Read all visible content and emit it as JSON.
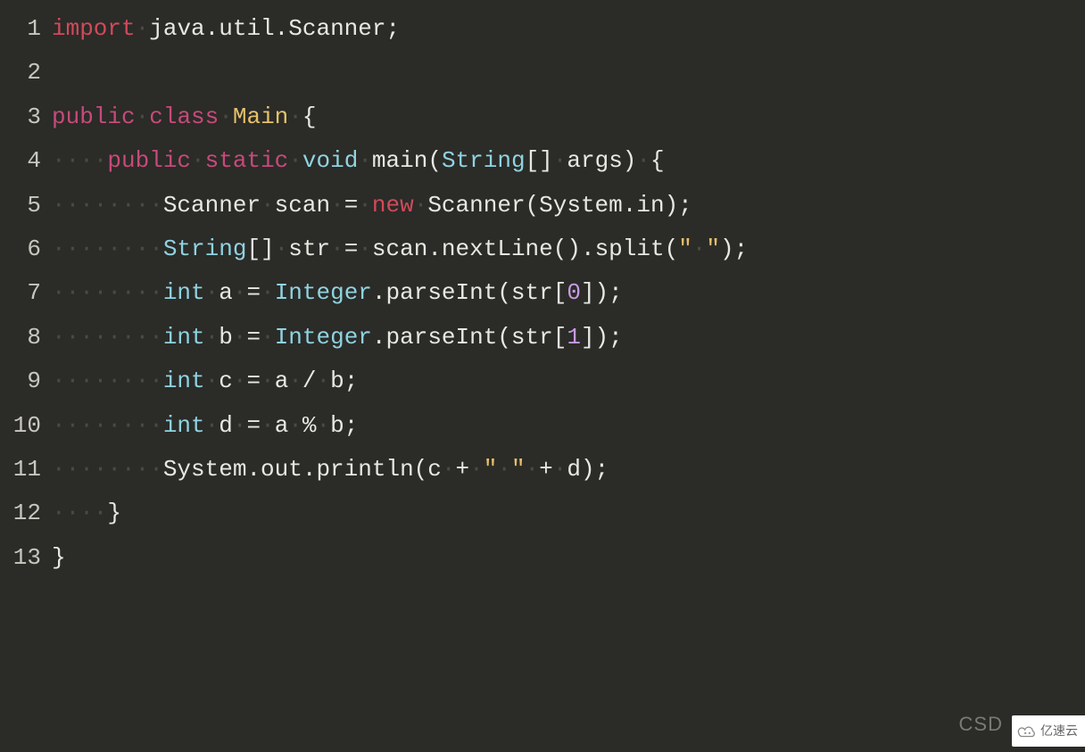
{
  "code": {
    "lines": [
      {
        "n": "1",
        "tokens": [
          {
            "t": "import",
            "c": "kw-red"
          },
          {
            "t": "·",
            "c": "dot"
          },
          {
            "t": "java.util.Scanner;",
            "c": "plain"
          }
        ]
      },
      {
        "n": "2",
        "tokens": []
      },
      {
        "n": "3",
        "tokens": [
          {
            "t": "public",
            "c": "kw-mag"
          },
          {
            "t": "·",
            "c": "dot"
          },
          {
            "t": "class",
            "c": "kw-mag"
          },
          {
            "t": "·",
            "c": "dot"
          },
          {
            "t": "Main",
            "c": "cls"
          },
          {
            "t": "·",
            "c": "dot"
          },
          {
            "t": "{",
            "c": "plain"
          }
        ]
      },
      {
        "n": "4",
        "tokens": [
          {
            "t": "····",
            "c": "dot"
          },
          {
            "t": "public",
            "c": "kw-mag"
          },
          {
            "t": "·",
            "c": "dot"
          },
          {
            "t": "static",
            "c": "kw-mag"
          },
          {
            "t": "·",
            "c": "dot"
          },
          {
            "t": "void",
            "c": "type"
          },
          {
            "t": "·",
            "c": "dot"
          },
          {
            "t": "main(",
            "c": "fn"
          },
          {
            "t": "String",
            "c": "type"
          },
          {
            "t": "[]",
            "c": "plain"
          },
          {
            "t": "·",
            "c": "dot"
          },
          {
            "t": "args)",
            "c": "plain"
          },
          {
            "t": "·",
            "c": "dot"
          },
          {
            "t": "{",
            "c": "plain"
          }
        ]
      },
      {
        "n": "5",
        "tokens": [
          {
            "t": "········",
            "c": "dot"
          },
          {
            "t": "Scanner",
            "c": "plain"
          },
          {
            "t": "·",
            "c": "dot"
          },
          {
            "t": "scan",
            "c": "plain"
          },
          {
            "t": "·",
            "c": "dot"
          },
          {
            "t": "=",
            "c": "plain"
          },
          {
            "t": "·",
            "c": "dot"
          },
          {
            "t": "new",
            "c": "kw-red"
          },
          {
            "t": "·",
            "c": "dot"
          },
          {
            "t": "Scanner(System.in);",
            "c": "plain"
          }
        ]
      },
      {
        "n": "6",
        "tokens": [
          {
            "t": "········",
            "c": "dot"
          },
          {
            "t": "String",
            "c": "type"
          },
          {
            "t": "[]",
            "c": "plain"
          },
          {
            "t": "·",
            "c": "dot"
          },
          {
            "t": "str",
            "c": "plain"
          },
          {
            "t": "·",
            "c": "dot"
          },
          {
            "t": "=",
            "c": "plain"
          },
          {
            "t": "·",
            "c": "dot"
          },
          {
            "t": "scan.nextLine().split(",
            "c": "plain"
          },
          {
            "t": "\"",
            "c": "str"
          },
          {
            "t": "·",
            "c": "dot"
          },
          {
            "t": "\"",
            "c": "str"
          },
          {
            "t": ");",
            "c": "plain"
          }
        ]
      },
      {
        "n": "7",
        "tokens": [
          {
            "t": "········",
            "c": "dot"
          },
          {
            "t": "int",
            "c": "type"
          },
          {
            "t": "·",
            "c": "dot"
          },
          {
            "t": "a",
            "c": "plain"
          },
          {
            "t": "·",
            "c": "dot"
          },
          {
            "t": "=",
            "c": "plain"
          },
          {
            "t": "·",
            "c": "dot"
          },
          {
            "t": "Integer",
            "c": "type"
          },
          {
            "t": ".parseInt(str[",
            "c": "plain"
          },
          {
            "t": "0",
            "c": "num"
          },
          {
            "t": "]);",
            "c": "plain"
          }
        ]
      },
      {
        "n": "8",
        "tokens": [
          {
            "t": "········",
            "c": "dot"
          },
          {
            "t": "int",
            "c": "type"
          },
          {
            "t": "·",
            "c": "dot"
          },
          {
            "t": "b",
            "c": "plain"
          },
          {
            "t": "·",
            "c": "dot"
          },
          {
            "t": "=",
            "c": "plain"
          },
          {
            "t": "·",
            "c": "dot"
          },
          {
            "t": "Integer",
            "c": "type"
          },
          {
            "t": ".parseInt(str[",
            "c": "plain"
          },
          {
            "t": "1",
            "c": "num"
          },
          {
            "t": "]);",
            "c": "plain"
          }
        ]
      },
      {
        "n": "9",
        "tokens": [
          {
            "t": "········",
            "c": "dot"
          },
          {
            "t": "int",
            "c": "type"
          },
          {
            "t": "·",
            "c": "dot"
          },
          {
            "t": "c",
            "c": "plain"
          },
          {
            "t": "·",
            "c": "dot"
          },
          {
            "t": "=",
            "c": "plain"
          },
          {
            "t": "·",
            "c": "dot"
          },
          {
            "t": "a",
            "c": "plain"
          },
          {
            "t": "·",
            "c": "dot"
          },
          {
            "t": "/",
            "c": "plain"
          },
          {
            "t": "·",
            "c": "dot"
          },
          {
            "t": "b;",
            "c": "plain"
          }
        ]
      },
      {
        "n": "10",
        "tokens": [
          {
            "t": "········",
            "c": "dot"
          },
          {
            "t": "int",
            "c": "type"
          },
          {
            "t": "·",
            "c": "dot"
          },
          {
            "t": "d",
            "c": "plain"
          },
          {
            "t": "·",
            "c": "dot"
          },
          {
            "t": "=",
            "c": "plain"
          },
          {
            "t": "·",
            "c": "dot"
          },
          {
            "t": "a",
            "c": "plain"
          },
          {
            "t": "·",
            "c": "dot"
          },
          {
            "t": "%",
            "c": "plain"
          },
          {
            "t": "·",
            "c": "dot"
          },
          {
            "t": "b;",
            "c": "plain"
          }
        ]
      },
      {
        "n": "11",
        "tokens": [
          {
            "t": "········",
            "c": "dot"
          },
          {
            "t": "System.out.println(c",
            "c": "plain"
          },
          {
            "t": "·",
            "c": "dot"
          },
          {
            "t": "+",
            "c": "plain"
          },
          {
            "t": "·",
            "c": "dot"
          },
          {
            "t": "\"",
            "c": "str"
          },
          {
            "t": "·",
            "c": "dot"
          },
          {
            "t": "\"",
            "c": "str"
          },
          {
            "t": "·",
            "c": "dot"
          },
          {
            "t": "+",
            "c": "plain"
          },
          {
            "t": "·",
            "c": "dot"
          },
          {
            "t": "d);",
            "c": "plain"
          }
        ]
      },
      {
        "n": "12",
        "tokens": [
          {
            "t": "····",
            "c": "dot"
          },
          {
            "t": "}",
            "c": "plain"
          }
        ]
      },
      {
        "n": "13",
        "tokens": [
          {
            "t": "}",
            "c": "plain"
          }
        ]
      }
    ]
  },
  "watermark": {
    "csd": "CSD",
    "badge_text": "亿速云"
  }
}
